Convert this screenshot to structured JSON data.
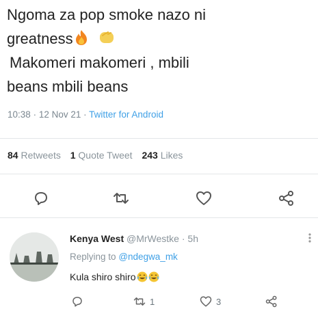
{
  "tweet": {
    "line1": "Ngoma za pop smoke nazo ni",
    "line2": "greatness",
    "line3": "Makomeri  makomeri , mbili",
    "line4": "beans mbili  beans",
    "emojis": [
      "fire-emoji",
      "clapping-hands-emoji"
    ],
    "time": "10:38",
    "date": "12 Nov 21",
    "separator": "·",
    "source": "Twitter for Android"
  },
  "stats": {
    "retweets_count": "84",
    "retweets_label": "Retweets",
    "quotes_count": "1",
    "quotes_label": "Quote Tweet",
    "likes_count": "243",
    "likes_label": "Likes"
  },
  "actions": [
    "reply-icon",
    "retweet-icon",
    "like-icon",
    "share-icon"
  ],
  "reply": {
    "name": "Kenya West",
    "handle": "@MrWestke",
    "time": "· 5h",
    "replying_prefix": "Replying to",
    "replying_to": "@ndegwa_mk",
    "text": "Kula shiro shiro",
    "emojis": [
      "laughing-crying-emoji",
      "laughing-crying-emoji"
    ],
    "retweets": "1",
    "likes": "3"
  },
  "colors": {
    "accent": "#3fa0e6",
    "muted": "#8a949b",
    "text": "#222222"
  }
}
